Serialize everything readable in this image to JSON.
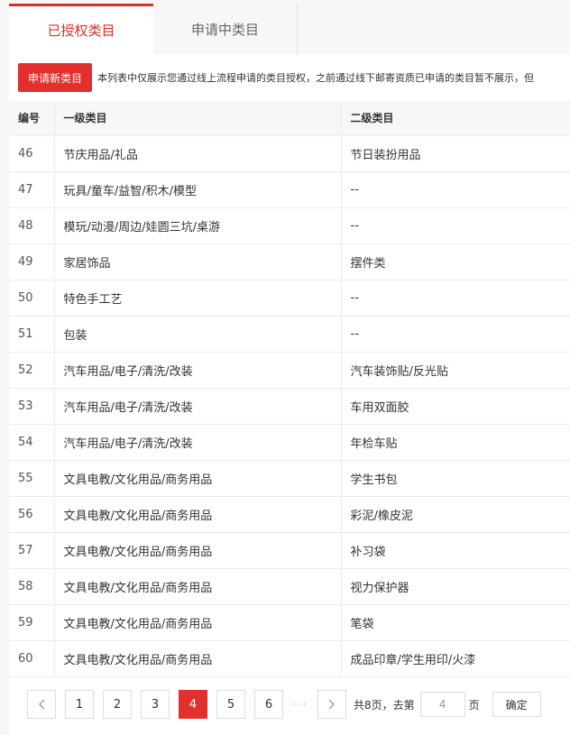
{
  "tabs": [
    {
      "label": "已授权类目",
      "active": true
    },
    {
      "label": "申请中类目",
      "active": false
    }
  ],
  "toolbar": {
    "apply_label": "申请新类目",
    "notice": "本列表中仅展示您通过线上流程申请的类目授权，之前通过线下邮寄资质已申请的类目暂不展示，但"
  },
  "table": {
    "headers": [
      "编号",
      "一级类目",
      "二级类目"
    ],
    "rows": [
      [
        "46",
        "节庆用品/礼品",
        "节日装扮用品"
      ],
      [
        "47",
        "玩具/童车/益智/积木/模型",
        "--"
      ],
      [
        "48",
        "模玩/动漫/周边/娃圆三坑/桌游",
        "--"
      ],
      [
        "49",
        "家居饰品",
        "摆件类"
      ],
      [
        "50",
        "特色手工艺",
        "--"
      ],
      [
        "51",
        "包装",
        "--"
      ],
      [
        "52",
        "汽车用品/电子/清洗/改装",
        "汽车装饰贴/反光贴"
      ],
      [
        "53",
        "汽车用品/电子/清洗/改装",
        "车用双面胶"
      ],
      [
        "54",
        "汽车用品/电子/清洗/改装",
        "年检车贴"
      ],
      [
        "55",
        "文具电教/文化用品/商务用品",
        "学生书包"
      ],
      [
        "56",
        "文具电教/文化用品/商务用品",
        "彩泥/橡皮泥"
      ],
      [
        "57",
        "文具电教/文化用品/商务用品",
        "补习袋"
      ],
      [
        "58",
        "文具电教/文化用品/商务用品",
        "视力保护器"
      ],
      [
        "59",
        "文具电教/文化用品/商务用品",
        "笔袋"
      ],
      [
        "60",
        "文具电教/文化用品/商务用品",
        "成品印章/学生用印/火漆"
      ]
    ]
  },
  "pagination": {
    "prev_icon": "chevron-left-icon",
    "next_icon": "chevron-right-icon",
    "pages": [
      "1",
      "2",
      "3",
      "4",
      "5",
      "6"
    ],
    "current": "4",
    "ellipsis": "···",
    "total_text": "共8页，去第",
    "page_unit": "页",
    "input_value": "4",
    "confirm_label": "确定"
  },
  "colors": {
    "accent": "#e3302d"
  }
}
